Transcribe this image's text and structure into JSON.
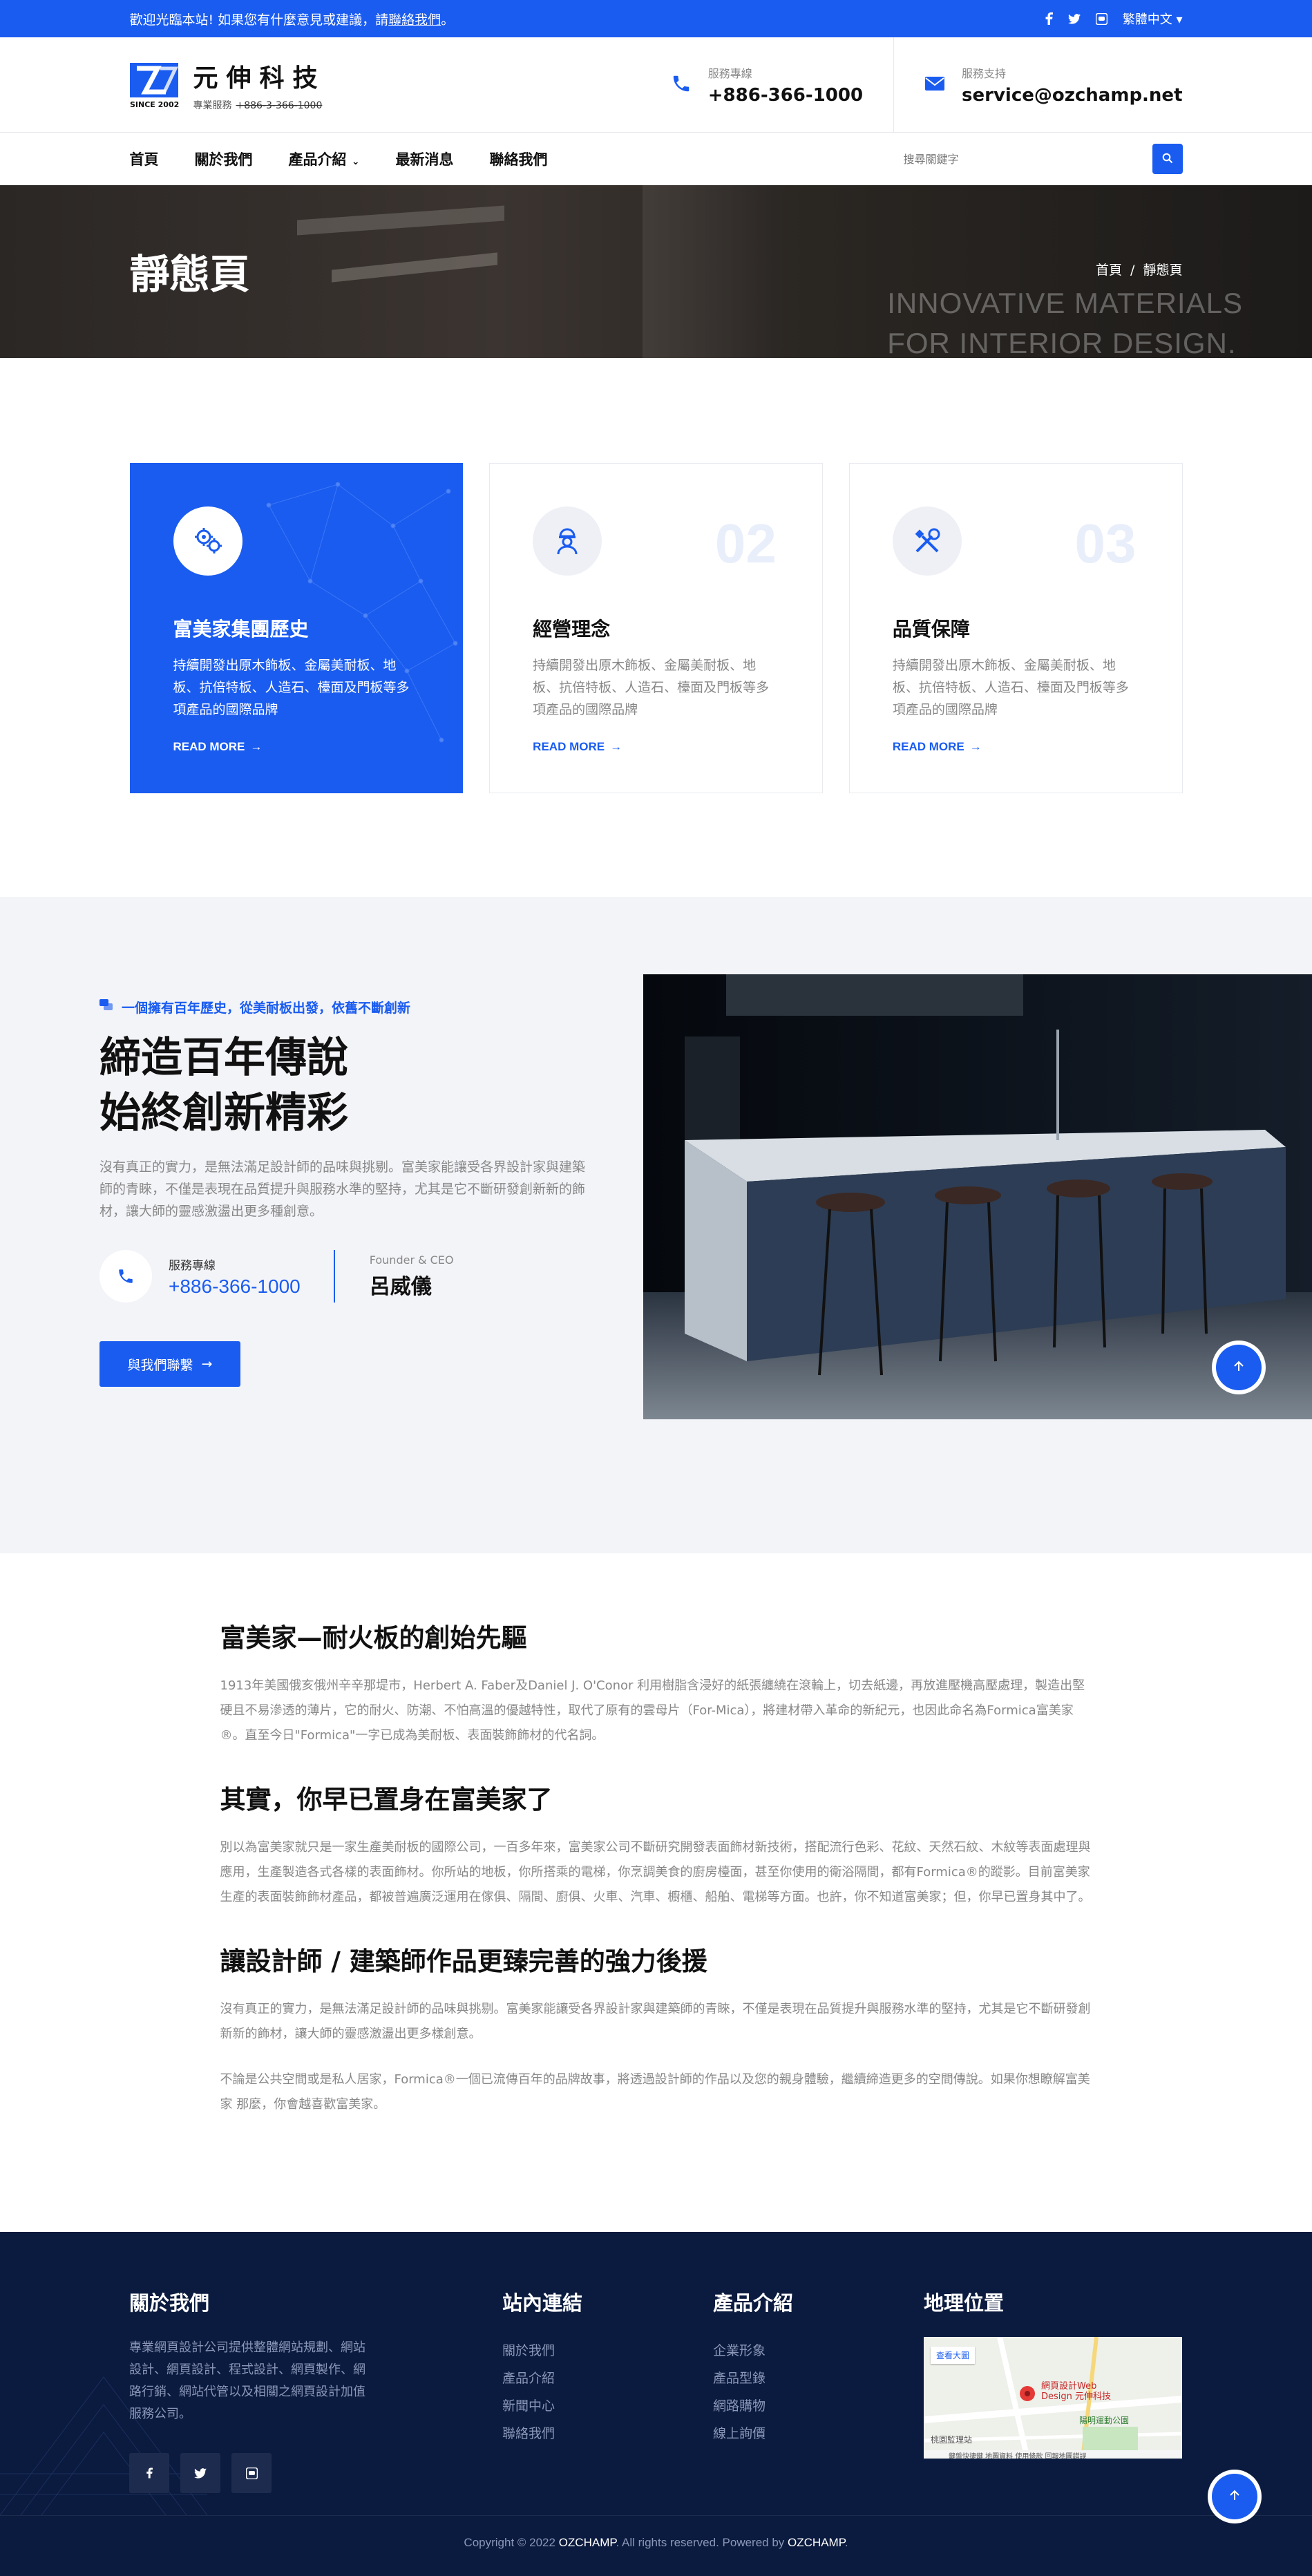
{
  "topbar": {
    "welcome_prefix": "歡迎光臨本站! 如果您有什麼意見或建議，請",
    "welcome_link": "聯絡我們",
    "welcome_suffix": "。",
    "language": "繁體中文"
  },
  "header": {
    "logo_mark_text": "SINCE 2002",
    "logo_name": "元伸科技",
    "logo_sub": "專業服務",
    "logo_phone": "+886-3-366-1000",
    "service_label": "服務專線",
    "service_value": "+886-366-1000",
    "support_label": "服務支持",
    "support_value": "service@ozchamp.net"
  },
  "nav": {
    "items": [
      "首頁",
      "關於我們",
      "產品介紹",
      "最新消息",
      "聯絡我們"
    ],
    "search_placeholder": "搜尋關鍵字"
  },
  "banner": {
    "title": "靜態頁",
    "crumb_home": "首頁",
    "crumb_sep": "/",
    "crumb_current": "靜態頁",
    "slogan_1": "INNOVATIVE MATERIALS",
    "slogan_2": "FOR INTERIOR DESIGN."
  },
  "cards": [
    {
      "num": "",
      "title": "富美家集團歷史",
      "text": "持續開發出原木飾板、金屬美耐板、地板、抗倍特板、人造石、檯面及門板等多項產品的國際品牌",
      "more": "READ MORE"
    },
    {
      "num": "02",
      "title": "經營理念",
      "text": "持續開發出原木飾板、金屬美耐板、地板、抗倍特板、人造石、檯面及門板等多項產品的國際品牌",
      "more": "READ MORE"
    },
    {
      "num": "03",
      "title": "品質保障",
      "text": "持續開發出原木飾板、金屬美耐板、地板、抗倍特板、人造石、檯面及門板等多項產品的國際品牌",
      "more": "READ MORE"
    }
  ],
  "about": {
    "tag": "一個擁有百年歷史，從美耐板出發，依舊不斷創新",
    "heading_1": "締造百年傳說",
    "heading_2": "始終創新精彩",
    "desc": "沒有真正的實力，是無法滿足設計師的品味與挑剔。富美家能讓受各界設計家與建築師的青睞，不僅是表現在品質提升與服務水準的堅持，尤其是它不斷研發創新新的飾材，讓大師的靈感激盪出更多種創意。",
    "phone_label": "服務專線",
    "phone_value": "+886-366-1000",
    "ceo_label": "Founder & CEO",
    "ceo_name": "呂威儀",
    "cta": "與我們聯繫"
  },
  "article": {
    "h1": "富美家—耐火板的創始先驅",
    "p1": "1913年美國俄亥俄州辛辛那堤市，Herbert A. Faber及Daniel J. O'Conor 利用樹脂含浸好的紙張纏繞在滾輪上，切去紙邊，再放進壓機高壓處理，製造出堅硬且不易滲透的薄片，它的耐火、防潮、不怕高溫的優越特性，取代了原有的雲母片（For-Mica），將建材帶入革命的新紀元，也因此命名為Formica富美家®。直至今日\"Formica\"一字已成為美耐板、表面裝飾飾材的代名詞。",
    "h2": "其實，你早已置身在富美家了",
    "p2": "別以為富美家就只是一家生產美耐板的國際公司，一百多年來，富美家公司不斷研究開發表面飾材新技術，搭配流行色彩、花紋、天然石紋、木紋等表面處理與應用，生產製造各式各樣的表面飾材。你所站的地板，你所搭乘的電梯，你烹調美食的廚房檯面，甚至你使用的衛浴隔間，都有Formica®的蹤影。目前富美家生產的表面裝飾飾材產品，都被普遍廣泛運用在傢俱、隔間、廚俱、火車、汽車、櫥櫃、船舶、電梯等方面。也許，你不知道富美家；但，你早已置身其中了。",
    "h3": "讓設計師 / 建築師作品更臻完善的強力後援",
    "p3": "沒有真正的實力，是無法滿足設計師的品味與挑剔。富美家能讓受各界設計家與建築師的青睞，不僅是表現在品質提升與服務水準的堅持，尤其是它不斷研發創新新的飾材，讓大師的靈感激盪出更多樣創意。",
    "p4": "不論是公共空間或是私人居家，Formica®一個已流傳百年的品牌故事，將透過設計師的作品以及您的親身體驗，繼續締造更多的空間傳說。如果你想瞭解富美家 那麼，你會越喜歡富美家。"
  },
  "footer": {
    "about_title": "關於我們",
    "about_text": "專業網頁設計公司提供整體網站規劃、網站設計、網頁設計、程式設計、網頁製作、網路行銷、網站代管以及相關之網頁設計加值服務公司。",
    "links_title": "站內連結",
    "links": [
      "關於我們",
      "產品介紹",
      "新聞中心",
      "聯絡我們"
    ],
    "products_title": "產品介紹",
    "products": [
      "企業形象",
      "產品型錄",
      "網路購物",
      "線上詢價"
    ],
    "map_title": "地理位置",
    "map_button": "查看大圖",
    "map_pin": "網頁設計Web Design 元伸科技",
    "map_park": "陽明運動公園",
    "map_station": "桃園監理站",
    "map_footer": "鍵盤快捷鍵  地圖資料  使用條款  回報地圖錯誤",
    "copyright_prefix": "Copyright © 2022 ",
    "copyright_brand": "OZCHAMP",
    "copyright_mid": ". All rights reserved. Powered by ",
    "copyright_by": "OZCHAMP",
    "copyright_end": "."
  },
  "colors": {
    "primary": "#1a5cf0",
    "footer_bg": "#0b1b3f",
    "about_bg": "#f3f4f8"
  }
}
